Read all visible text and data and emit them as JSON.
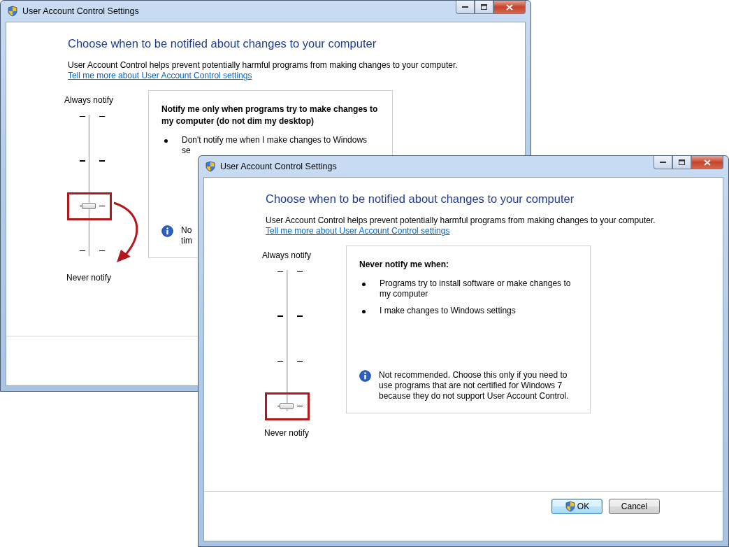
{
  "windows": [
    {
      "title": "User Account Control Settings",
      "heading": "Choose when to be notified about changes to your computer",
      "intro": "User Account Control helps prevent potentially harmful programs from making changes to your computer.",
      "link": "Tell me more about User Account Control settings",
      "slider": {
        "top_label": "Always notify",
        "bottom_label": "Never notify",
        "level": 0.3333,
        "highlighted": true
      },
      "arrow": true,
      "description": {
        "heading": "Notify me only when programs try to make changes to my computer (do not dim my desktop)",
        "bullets": [
          {
            "lines": [
              "Don't notify me when I make changes to Windows",
              "se"
            ]
          }
        ],
        "note_lines": [
          "No",
          "tim"
        ]
      }
    },
    {
      "title": "User Account Control Settings",
      "heading": "Choose when to be notified about changes to your computer",
      "intro": "User Account Control helps prevent potentially harmful programs from making changes to your computer.",
      "link": "Tell me more about User Account Control settings",
      "slider": {
        "top_label": "Always notify",
        "bottom_label": "Never notify",
        "level": 0,
        "highlighted": true
      },
      "description": {
        "heading": "Never notify me when:",
        "bullets": [
          {
            "lines": [
              "Programs try to install software or make changes to",
              "my computer"
            ]
          },
          {
            "lines": [
              "I make changes to Windows settings"
            ]
          }
        ],
        "note_lines": [
          "Not recommended. Choose this only if you need to",
          "use programs that are not certified for Windows 7",
          "because they do not support User Account Control."
        ]
      },
      "buttons": [
        {
          "label": "OK",
          "shield": true,
          "default": true
        },
        {
          "label": "Cancel",
          "shield": false,
          "default": false
        }
      ]
    }
  ]
}
